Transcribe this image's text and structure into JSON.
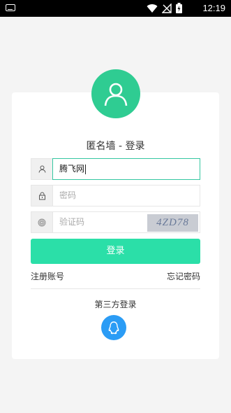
{
  "status_bar": {
    "time": "12:19"
  },
  "title": "匿名墙 - 登录",
  "fields": {
    "username": {
      "value": "腾飞网"
    },
    "password": {
      "placeholder": "密码"
    },
    "captcha": {
      "placeholder": "验证码",
      "image_text": "4ZD78"
    }
  },
  "login_button": "登录",
  "register_link": "注册账号",
  "forgot_link": "忘记密码",
  "third_party_label": "第三方登录",
  "colors": {
    "accent": "#2fcc92",
    "button": "#2bdfa8",
    "qq": "#2b9cf5",
    "focus_border": "#35c7a1"
  },
  "icons": [
    "keyboard-icon",
    "wifi-icon",
    "no-signal-icon",
    "battery-icon",
    "user-icon",
    "lock-icon",
    "fingerprint-icon",
    "qq-icon"
  ]
}
